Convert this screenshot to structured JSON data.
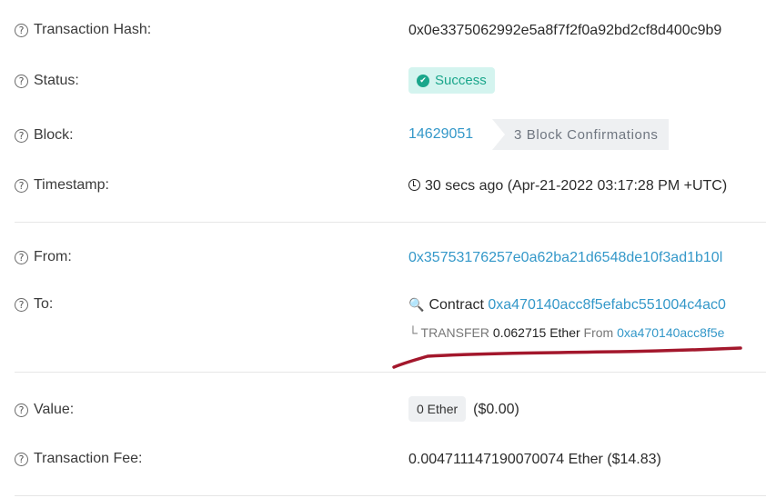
{
  "tx_hash": {
    "label": "Transaction Hash:",
    "value": "0x0e3375062992e5a8f7f2f0a92bd2cf8d400c9b9"
  },
  "status": {
    "label": "Status:",
    "badge": "Success"
  },
  "block": {
    "label": "Block:",
    "number": "14629051",
    "confirmations": "3 Block Confirmations"
  },
  "timestamp": {
    "label": "Timestamp:",
    "value": "30 secs ago (Apr-21-2022 03:17:28 PM +UTC)"
  },
  "from": {
    "label": "From:",
    "address": "0x35753176257e0a62ba21d6548de10f3ad1b10l"
  },
  "to": {
    "label": "To:",
    "contract_prefix": "Contract",
    "contract_address": "0xa470140acc8f5efabc551004c4ac0",
    "transfer_prefix": "└ TRANSFER",
    "transfer_amount": "0.062715 Ether",
    "transfer_from_label": "From",
    "transfer_from_address": "0xa470140acc8f5e"
  },
  "value": {
    "label": "Value:",
    "pill": "0 Ether",
    "usd": "($0.00)"
  },
  "fee": {
    "label": "Transaction Fee:",
    "value": "0.004711147190070074 Ether ($14.83)"
  },
  "icons": {
    "help": "question-circle-icon",
    "check": "check-circle-icon",
    "clock": "clock-icon",
    "contract": "search-contract-icon"
  },
  "colors": {
    "link": "#3498c9",
    "success": "#1aa68b",
    "success_bg": "#d4f4ef",
    "annotation": "#a3172c"
  }
}
